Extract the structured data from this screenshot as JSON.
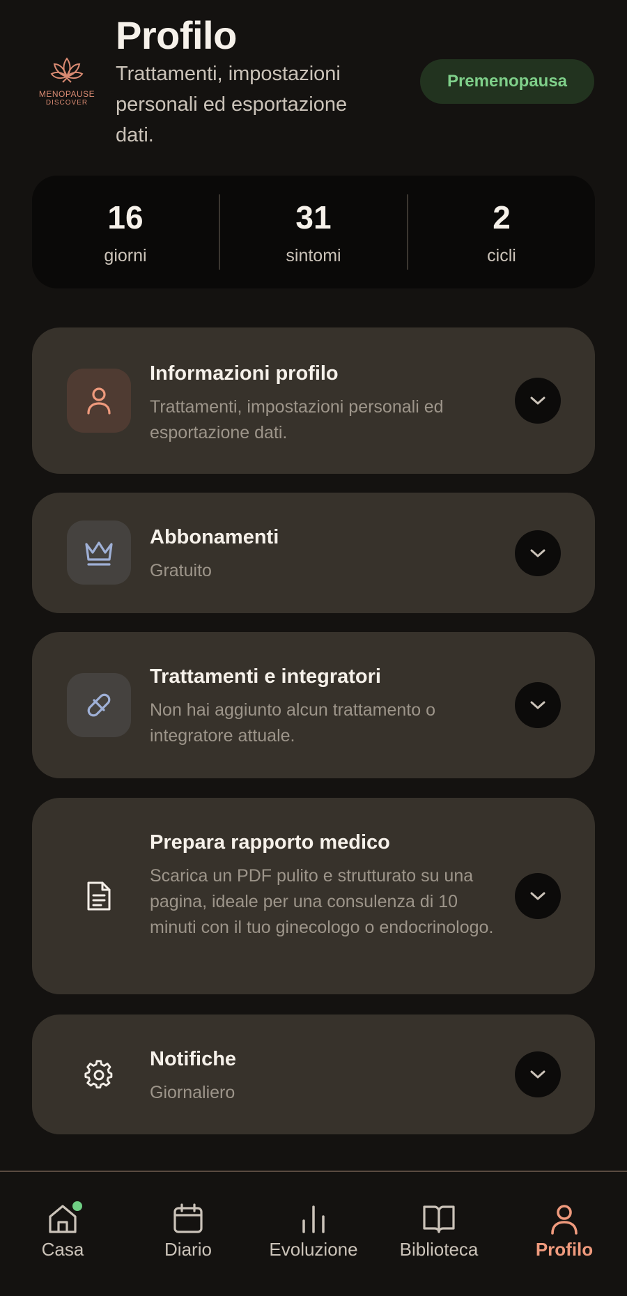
{
  "header": {
    "title": "Profilo",
    "subtitle": "Trattamenti, impostazioni personali ed esportazione dati.",
    "badge": "Premenopausa",
    "logo_line1": "MENOPAUSE",
    "logo_line2": "DISCOVER"
  },
  "stats": [
    {
      "value": "16",
      "label": "giorni"
    },
    {
      "value": "31",
      "label": "sintomi"
    },
    {
      "value": "2",
      "label": "cicli"
    }
  ],
  "cards": [
    {
      "icon": "user-icon",
      "title": "Informazioni profilo",
      "description": "Trattamenti, impostazioni personali ed esportazione dati."
    },
    {
      "icon": "crown-icon",
      "title": "Abbonamenti",
      "description": "Gratuito"
    },
    {
      "icon": "pill-icon",
      "title": "Trattamenti e integratori",
      "description": "Non hai aggiunto alcun trattamento o integratore attuale."
    },
    {
      "icon": "document-icon",
      "title": "Prepara rapporto medico",
      "description": "Scarica un PDF pulito e strutturato su una pagina, ideale per una consulenza di 10 minuti con il tuo ginecologo o endocrinologo."
    },
    {
      "icon": "gear-icon",
      "title": "Notifiche",
      "description": "Giornaliero"
    }
  ],
  "nav": [
    {
      "icon": "home-icon",
      "label": "Casa",
      "active": false,
      "notification": true
    },
    {
      "icon": "calendar-icon",
      "label": "Diario",
      "active": false
    },
    {
      "icon": "bar-chart-icon",
      "label": "Evoluzione",
      "active": false
    },
    {
      "icon": "book-icon",
      "label": "Biblioteca",
      "active": false
    },
    {
      "icon": "user-icon",
      "label": "Profilo",
      "active": true
    }
  ],
  "colors": {
    "background": "#141210",
    "card": "#37322b",
    "accent": "#ef9a7d",
    "badge_bg": "#22331f",
    "badge_text": "#7fd08a"
  }
}
